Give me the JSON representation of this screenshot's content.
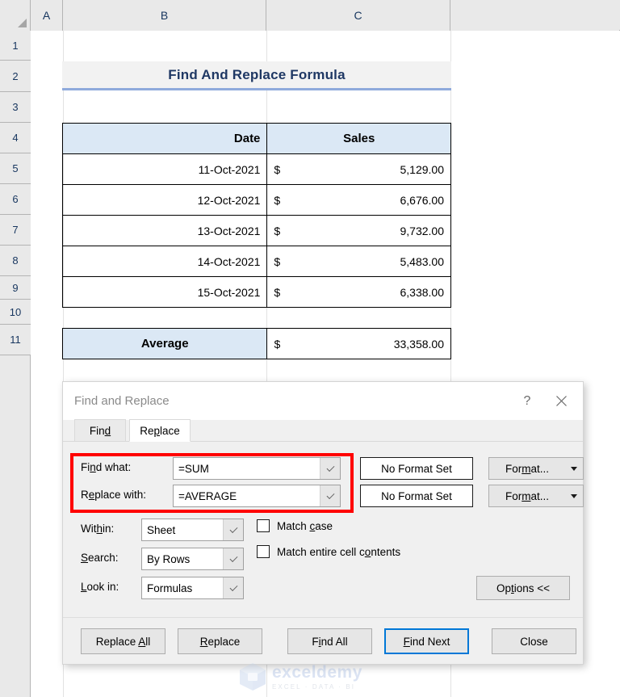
{
  "grid": {
    "column_headers": [
      "A",
      "B",
      "C"
    ],
    "row_headers": [
      "1",
      "2",
      "3",
      "4",
      "5",
      "6",
      "7",
      "8",
      "9",
      "10",
      "11"
    ]
  },
  "worksheet": {
    "title": "Find And Replace Formula",
    "table": {
      "headers": [
        "Date",
        "Sales"
      ],
      "currency_symbol": "$",
      "rows": [
        {
          "date": "11-Oct-2021",
          "sales": "5,129.00"
        },
        {
          "date": "12-Oct-2021",
          "sales": "6,676.00"
        },
        {
          "date": "13-Oct-2021",
          "sales": "9,732.00"
        },
        {
          "date": "14-Oct-2021",
          "sales": "5,483.00"
        },
        {
          "date": "15-Oct-2021",
          "sales": "6,338.00"
        }
      ]
    },
    "summary": {
      "label": "Average",
      "currency_symbol": "$",
      "value": "33,358.00"
    }
  },
  "dialog": {
    "title": "Find and Replace",
    "help_button": "?",
    "close_button": "✕",
    "tabs": [
      {
        "id": "find",
        "label_before": "Fin",
        "label_accel": "d",
        "label_after": ""
      },
      {
        "id": "replace",
        "label_before": "Re",
        "label_accel": "p",
        "label_after": "lace"
      }
    ],
    "fields": {
      "find_what": {
        "label_before": "Fi",
        "label_accel": "n",
        "label_after": "d what:",
        "value": "=SUM",
        "format_preview": "No Format Set",
        "format_button_before": "For",
        "format_button_accel": "m",
        "format_button_after": "at..."
      },
      "replace_with": {
        "label_before": "R",
        "label_accel": "e",
        "label_after": "place with:",
        "value": "=AVERAGE",
        "format_preview": "No Format Set",
        "format_button_before": "For",
        "format_button_accel": "m",
        "format_button_after": "at..."
      }
    },
    "options": {
      "within": {
        "label_before": "Wit",
        "label_accel": "h",
        "label_after": "in:",
        "value": "Sheet"
      },
      "search": {
        "label_before": "",
        "label_accel": "S",
        "label_after": "earch:",
        "value": "By Rows"
      },
      "look_in": {
        "label_before": "",
        "label_accel": "L",
        "label_after": "ook in:",
        "value": "Formulas"
      },
      "match_case": {
        "label_before": "Match ",
        "label_accel": "c",
        "label_after": "ase",
        "checked": false
      },
      "match_entire": {
        "label_before": "Match entire cell c",
        "label_accel": "o",
        "label_after": "ntents",
        "checked": false
      },
      "options_button": {
        "label_before": "Op",
        "label_accel": "t",
        "label_after": "ions <<"
      }
    },
    "buttons": [
      {
        "id": "replace-all",
        "before": "Replace ",
        "accel": "A",
        "after": "ll",
        "focused": false
      },
      {
        "id": "replace",
        "before": "",
        "accel": "R",
        "after": "eplace",
        "focused": false
      },
      {
        "id": "find-all",
        "before": "F",
        "accel": "i",
        "after": "nd All",
        "focused": false
      },
      {
        "id": "find-next",
        "before": "",
        "accel": "F",
        "after": "ind Next",
        "focused": true
      },
      {
        "id": "close",
        "before": "Close",
        "accel": "",
        "after": "",
        "focused": false
      }
    ]
  },
  "watermark": {
    "name": "exceldemy",
    "tagline": "EXCEL · DATA · BI"
  },
  "colors": {
    "title_text": "#1f3864",
    "title_underline": "#8faadc",
    "header_fill": "#dbe8f5",
    "highlight_box": "#ff0000",
    "focus_border": "#0078d7"
  }
}
